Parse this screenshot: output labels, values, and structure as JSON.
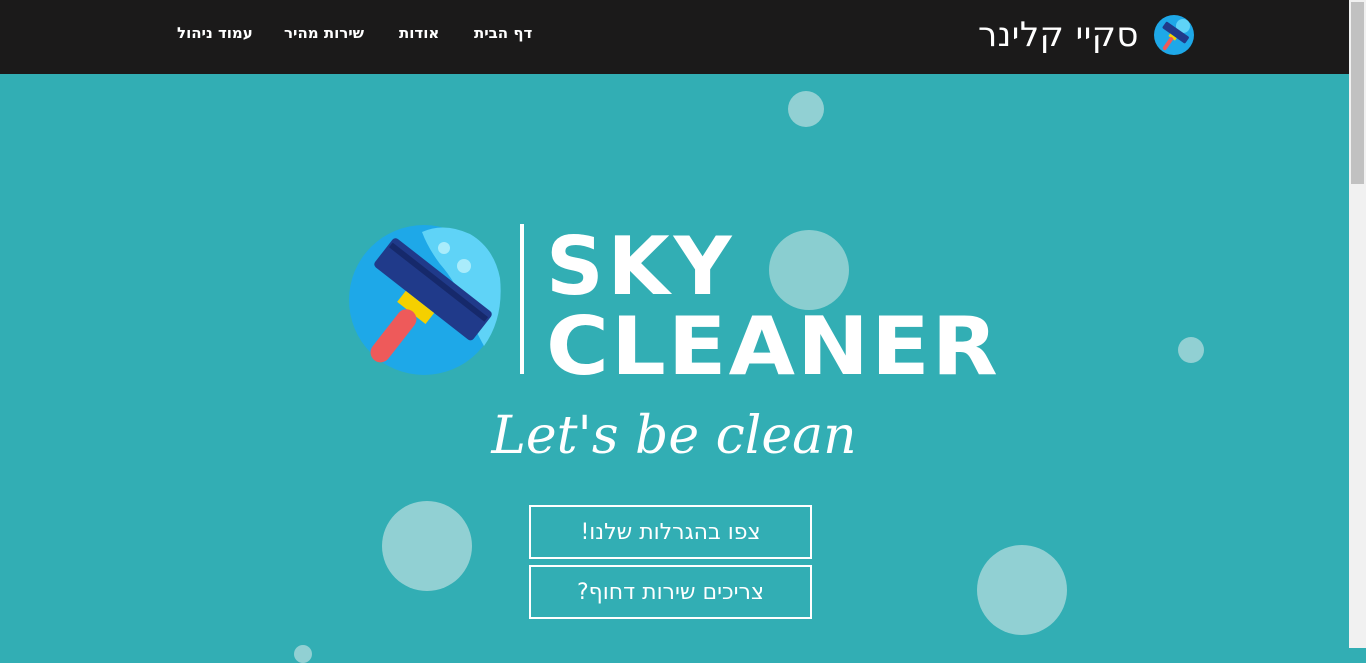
{
  "brand": {
    "title": "סקיי קלינר",
    "logo_icon": "squeegee-logo-icon"
  },
  "nav": {
    "items": [
      {
        "label": "דף הבית"
      },
      {
        "label": "אודות"
      },
      {
        "label": "שירות מהיר"
      },
      {
        "label": "עמוד ניהול"
      }
    ]
  },
  "hero": {
    "logo_line1": "SKY",
    "logo_line2": "CLEANER",
    "tagline": "Let's be clean",
    "logo_icon": "squeegee-icon"
  },
  "buttons": {
    "raffles": "צפו בהגרלות שלנו!",
    "urgent": "צריכים שירות דחוף?"
  },
  "colors": {
    "background": "#32aeb4",
    "navbar": "#1b1a1a",
    "bubble": "#91d0d3",
    "text": "#ffffff"
  }
}
